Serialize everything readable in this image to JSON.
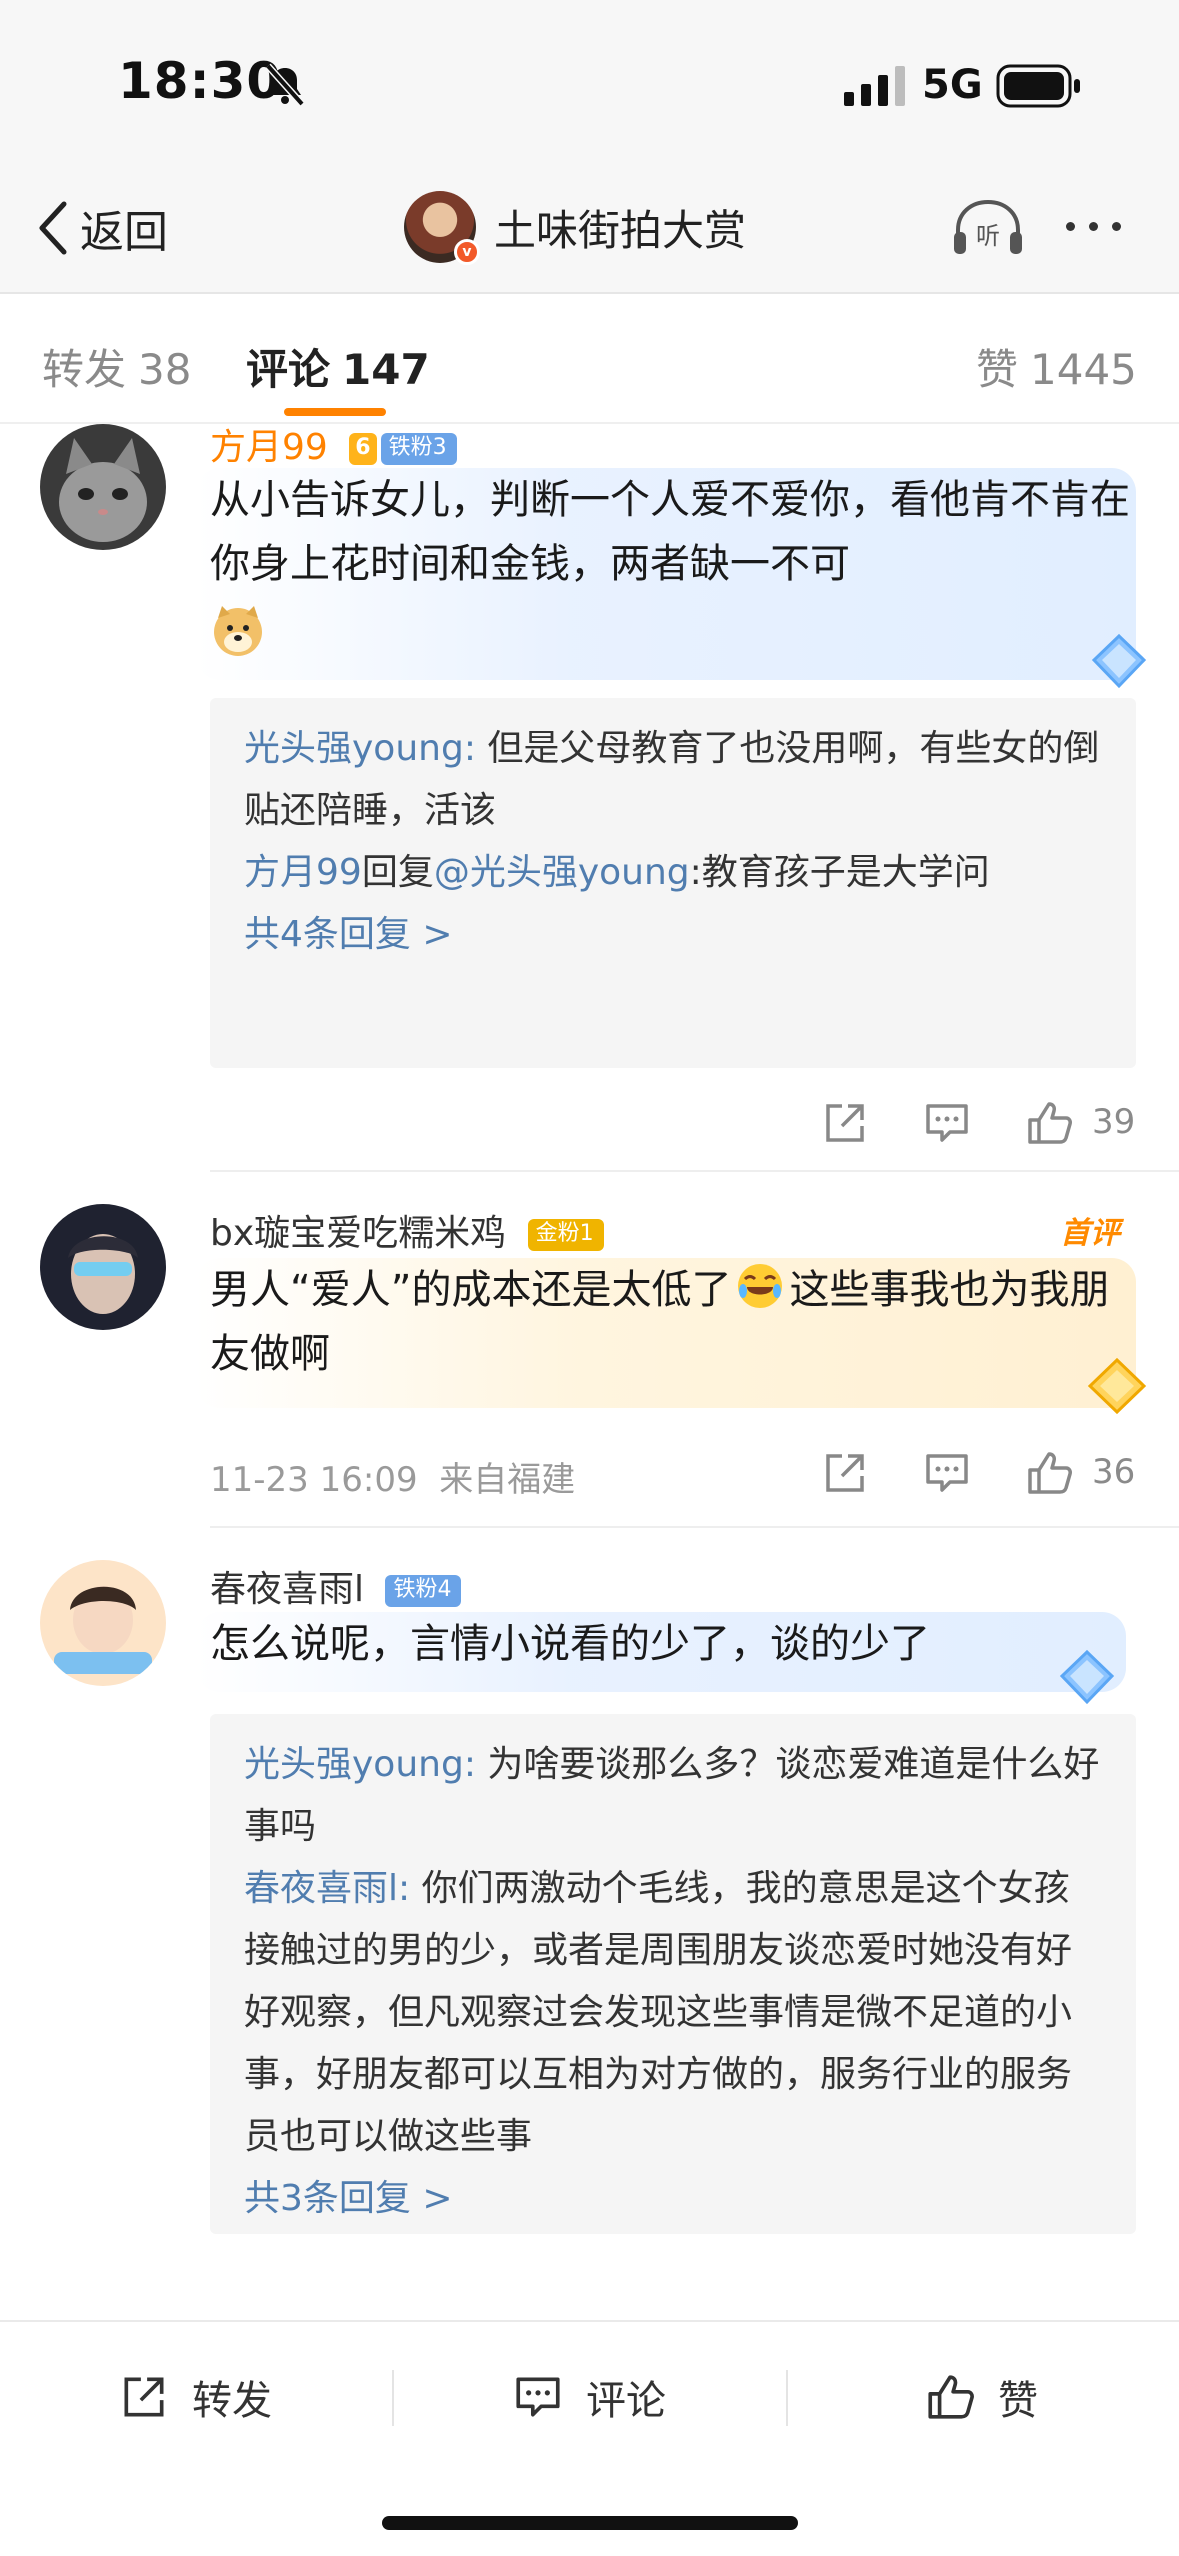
{
  "status": {
    "time": "18:30",
    "network": "5G"
  },
  "nav": {
    "back_label": "返回",
    "title": "土味街拍大赏",
    "listen_label": "听"
  },
  "tabs": [
    {
      "label": "转发",
      "count": "38"
    },
    {
      "label": "评论",
      "count": "147"
    },
    {
      "label": "赞",
      "count": "1445"
    }
  ],
  "comments": [
    {
      "name": "方月99",
      "level": "6",
      "badge": "铁粉3",
      "text": "从小告诉女儿，判断一个人爱不爱你，看他肯不肯在你身上花时间和金钱，两者缺一不可",
      "emoji": "doge-icon",
      "replies": [
        {
          "user": "光头强young:",
          "text": " 但是父母教育了也没用啊，有些女的倒贴还陪睡，活该"
        },
        {
          "user": "方月99",
          "mid": "回复",
          "target": "@光头强young",
          "text": ":教育孩子是大学问"
        }
      ],
      "more": "共4条回复 >",
      "likes": "39"
    },
    {
      "name": "bx璇宝爱吃糯米鸡",
      "badge": "金粉1",
      "tag": "首评",
      "text_a": "男人“爱人”的成本还是太低了",
      "text_b": "这些事我也为我朋友做啊",
      "time": "11-23 16:09",
      "location": "来自福建",
      "likes": "36"
    },
    {
      "name": "春夜喜雨l",
      "badge": "铁粉4",
      "text": "怎么说呢，言情小说看的少了，谈的少了",
      "replies": [
        {
          "user": "光头强young:",
          "text": " 为啥要谈那么多？谈恋爱难道是什么好事吗"
        },
        {
          "user": "春夜喜雨l:",
          "text": " 你们两激动个毛线，我的意思是这个女孩接触过的男的少，或者是周围朋友谈恋爱时她没有好好观察，但凡观察过会发现这些事情是微不足道的小事，好朋友都可以互相为对方做的，服务行业的服务员也可以做这些事"
        }
      ],
      "more": "共3条回复 >"
    }
  ],
  "bottom_bar": {
    "repost": "转发",
    "comment": "评论",
    "like": "赞"
  },
  "colors": {
    "accent": "#ff8200",
    "link": "#507daf"
  }
}
